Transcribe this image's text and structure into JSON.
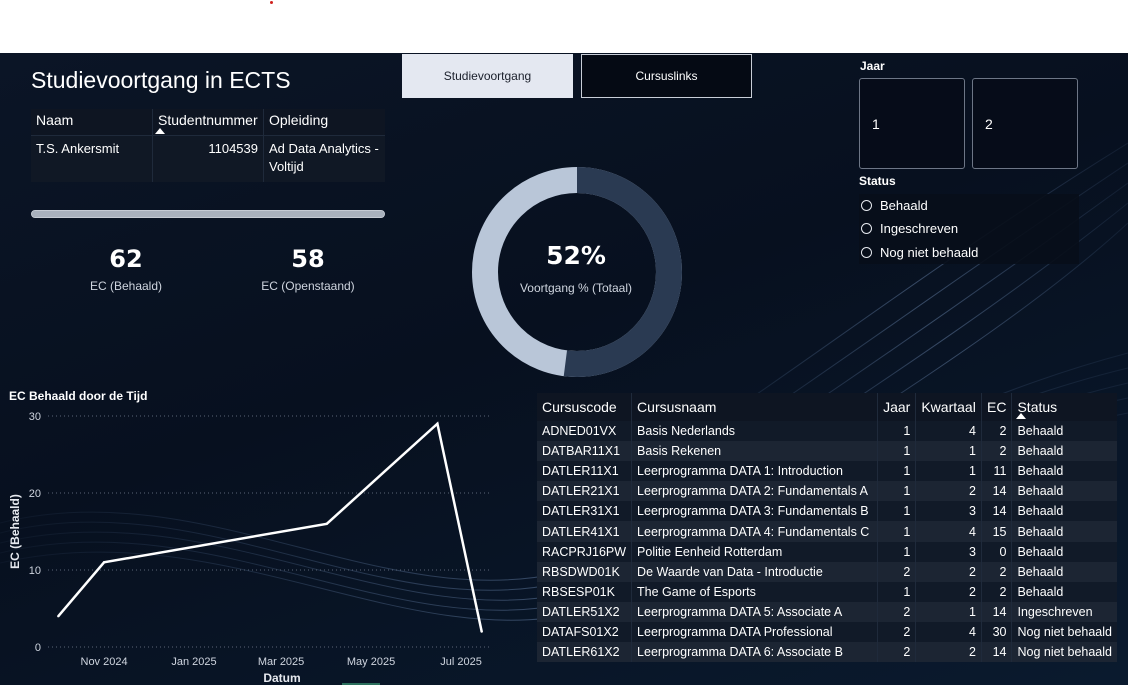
{
  "page": {
    "title": "Studievoortgang in ECTS"
  },
  "tabs": [
    {
      "label": "Studievoortgang",
      "active": true
    },
    {
      "label": "Cursuslinks",
      "active": false
    }
  ],
  "student_table": {
    "headers": [
      "Naam",
      "Studentnummer",
      "Opleiding"
    ],
    "row": [
      "T.S. Ankersmit",
      "1104539",
      "Ad Data Analytics - Voltijd"
    ]
  },
  "progress": {
    "fraction": 1.0
  },
  "kpis": [
    {
      "value": "62",
      "label": "EC (Behaald)"
    },
    {
      "value": "58",
      "label": "EC (Openstaand)"
    }
  ],
  "donut": {
    "value": "52%",
    "label": "Voortgang % (Totaal)",
    "percent": 52,
    "colors": {
      "done": "#2a3a52",
      "remaining": "#b9c6d8"
    }
  },
  "filters": {
    "year_label": "Jaar",
    "years": [
      "1",
      "2"
    ],
    "status_label": "Status",
    "statuses": [
      "Behaald",
      "Ingeschreven",
      "Nog niet behaald"
    ]
  },
  "chart_title": "EC Behaald door de Tijd",
  "chart_data": {
    "type": "line",
    "title": "EC Behaald door de Tijd",
    "xlabel": "Datum",
    "ylabel": "EC (Behaald)",
    "x_ticks": [
      "Nov 2024",
      "Jan 2025",
      "Mar 2025",
      "May 2025",
      "Jul 2025"
    ],
    "y_ticks": [
      "0",
      "10",
      "20",
      "30"
    ],
    "ylim": [
      0,
      30
    ],
    "x_domain": [
      "2024-09-24",
      "2025-07-22"
    ],
    "grid": true,
    "x": [
      "2024-10-01",
      "2024-11-01",
      "2025-04-01",
      "2025-06-15",
      "2025-07-15"
    ],
    "y": [
      4,
      11,
      16,
      29,
      2
    ]
  },
  "course_table": {
    "headers": [
      "Cursuscode",
      "Cursusnaam",
      "Jaar",
      "Kwartaal",
      "EC",
      "Status"
    ],
    "rows": [
      [
        "ADNED01VX",
        "Basis Nederlands",
        "1",
        "4",
        "2",
        "Behaald"
      ],
      [
        "DATBAR11X1",
        "Basis Rekenen",
        "1",
        "1",
        "2",
        "Behaald"
      ],
      [
        "DATLER11X1",
        "Leerprogramma DATA 1: Introduction",
        "1",
        "1",
        "11",
        "Behaald"
      ],
      [
        "DATLER21X1",
        "Leerprogramma DATA 2: Fundamentals A",
        "1",
        "2",
        "14",
        "Behaald"
      ],
      [
        "DATLER31X1",
        "Leerprogramma DATA 3: Fundamentals B",
        "1",
        "3",
        "14",
        "Behaald"
      ],
      [
        "DATLER41X1",
        "Leerprogramma DATA 4: Fundamentals C",
        "1",
        "4",
        "15",
        "Behaald"
      ],
      [
        "RACPRJ16PW",
        "Politie Eenheid Rotterdam",
        "1",
        "3",
        "0",
        "Behaald"
      ],
      [
        "RBSDWD01K",
        "De Waarde van Data - Introductie",
        "2",
        "2",
        "2",
        "Behaald"
      ],
      [
        "RBSESP01K",
        "The Game of Esports",
        "1",
        "2",
        "2",
        "Behaald"
      ],
      [
        "DATLER51X2",
        "Leerprogramma DATA 5: Associate A",
        "2",
        "1",
        "14",
        "Ingeschreven"
      ],
      [
        "DATAFS01X2",
        "Leerprogramma DATA Professional",
        "2",
        "4",
        "30",
        "Nog niet behaald"
      ],
      [
        "DATLER61X2",
        "Leerprogramma DATA 6: Associate B",
        "2",
        "2",
        "14",
        "Nog niet behaald"
      ]
    ]
  }
}
